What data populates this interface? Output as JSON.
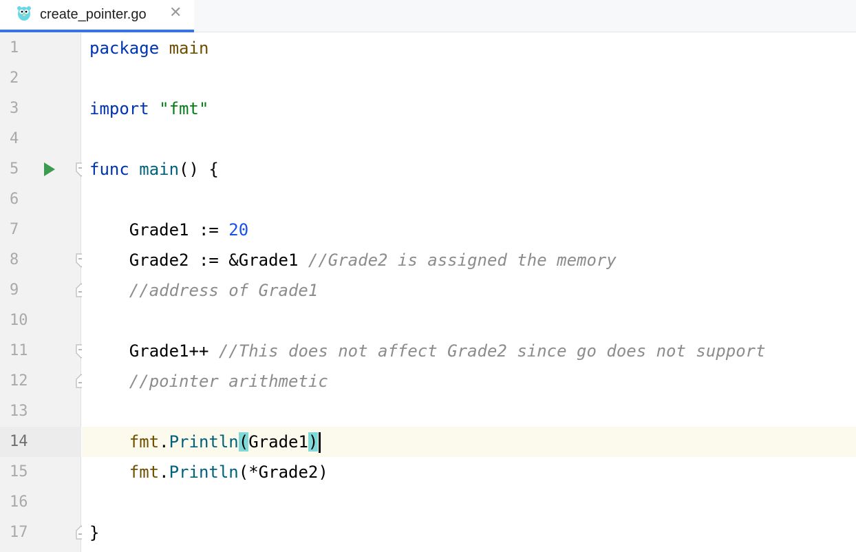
{
  "tab": {
    "filename": "create_pointer.go",
    "close_glyph": "✕",
    "icon": "gopher-icon"
  },
  "editor": {
    "current_line": 14,
    "line_numbers": [
      "1",
      "2",
      "3",
      "4",
      "5",
      "6",
      "7",
      "8",
      "9",
      "10",
      "11",
      "12",
      "13",
      "14",
      "15",
      "16",
      "17"
    ],
    "run_marker_line": 5,
    "lines": {
      "l1": {
        "kw": "package",
        "sp": " ",
        "name": "main"
      },
      "l3": {
        "kw": "import",
        "sp": " ",
        "str": "\"fmt\""
      },
      "l5": {
        "kw": "func",
        "sp": " ",
        "fn": "main",
        "rest": "() {"
      },
      "l7": {
        "indent": "    ",
        "ident": "Grade1 := ",
        "num": "20"
      },
      "l8": {
        "indent": "    ",
        "ident": "Grade2 := &Grade1 ",
        "comment": "//Grade2 is assigned the memory"
      },
      "l9": {
        "indent": "    ",
        "comment": "//address of Grade1"
      },
      "l11": {
        "indent": "    ",
        "ident": "Grade1++ ",
        "comment": "//This does not affect Grade2 since go does not support"
      },
      "l12": {
        "indent": "    ",
        "comment": "//pointer arithmetic"
      },
      "l14": {
        "indent": "    ",
        "pkg": "fmt",
        "dot": ".",
        "fn": "Println",
        "open": "(",
        "arg": "Grade1",
        "close": ")"
      },
      "l15": {
        "indent": "    ",
        "pkg": "fmt",
        "dot": ".",
        "fn": "Println",
        "rest": "(*Grade2)"
      },
      "l17": {
        "text": "}"
      }
    }
  },
  "colors": {
    "keyword": "#0033b3",
    "package_ref": "#6f4e00",
    "string": "#067d17",
    "function": "#00627a",
    "number": "#1750eb",
    "comment": "#8c8c8c",
    "current_line_bg": "#fcfaed",
    "brace_match_bg": "#7fd9d9",
    "tab_accent": "#3574f0",
    "run_icon": "#3d9b4f"
  }
}
